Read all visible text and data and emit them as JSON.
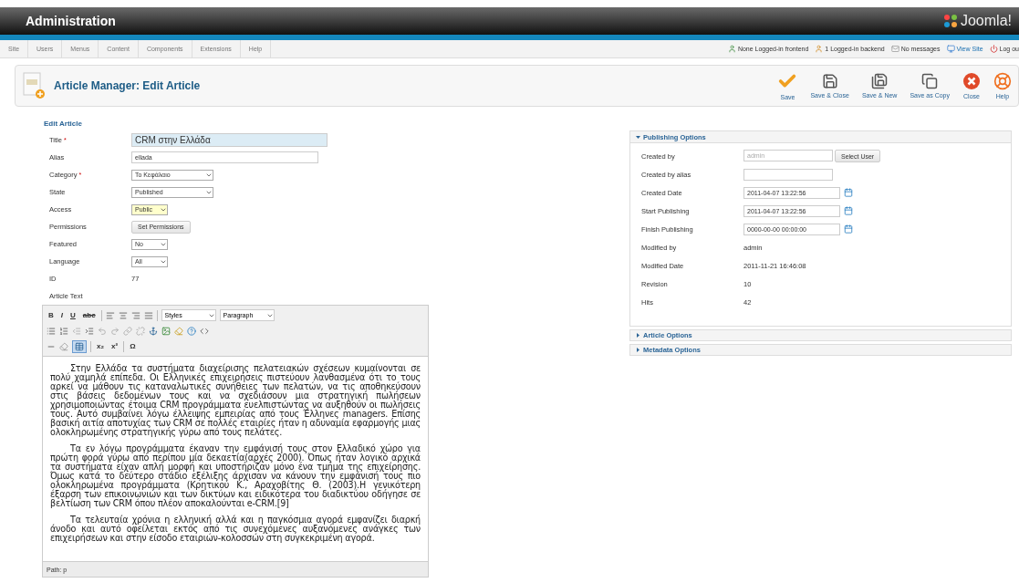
{
  "header": {
    "title": "Administration",
    "logo_text": "Joomla!"
  },
  "menu": {
    "items": [
      "Site",
      "Users",
      "Menus",
      "Content",
      "Components",
      "Extensions",
      "Help"
    ],
    "status": [
      {
        "kind": "frontend",
        "label": "None Logged-in frontend"
      },
      {
        "kind": "backend",
        "label": "1 Logged-in backend"
      },
      {
        "kind": "messages",
        "label": "No messages"
      },
      {
        "kind": "view",
        "label": "View Site"
      },
      {
        "kind": "logout",
        "label": "Log ou"
      }
    ]
  },
  "toolbar": {
    "title": "Article Manager: Edit Article",
    "buttons": [
      {
        "kind": "save",
        "label": "Save"
      },
      {
        "kind": "save_close",
        "label": "Save & Close"
      },
      {
        "kind": "save_new",
        "label": "Save & New"
      },
      {
        "kind": "save_copy",
        "label": "Save as Copy"
      },
      {
        "kind": "close",
        "label": "Close"
      },
      {
        "kind": "help",
        "label": "Help"
      }
    ]
  },
  "edit_article": {
    "legend": "Edit Article",
    "fields": [
      {
        "label": "Title",
        "mark": "*",
        "kind": "title",
        "value": "CRM στην Ελλάδα"
      },
      {
        "label": "Alias",
        "kind": "text",
        "value": "ellada"
      },
      {
        "label": "Category",
        "mark": "*",
        "kind": "select",
        "value": "Το Κεφάλαιο",
        "focused": false
      },
      {
        "label": "State",
        "kind": "select",
        "value": "Published",
        "focused": false
      },
      {
        "label": "Access",
        "kind": "select",
        "value": "Public",
        "focused": true
      },
      {
        "label": "Permissions",
        "kind": "button",
        "value": "Set Permissions"
      },
      {
        "label": "Featured",
        "kind": "select",
        "value": "No",
        "focused": false
      },
      {
        "label": "Language",
        "kind": "select",
        "value": "All",
        "focused": false
      },
      {
        "label": "ID",
        "kind": "value",
        "value": "77"
      }
    ],
    "text_label": "Article Text"
  },
  "editor": {
    "format_buttons": [
      "B",
      "I",
      "U",
      "abc"
    ],
    "selects": [
      "Styles",
      "Paragraph"
    ],
    "script_buttons": [
      "x₂",
      "x²",
      "Ω"
    ],
    "paragraphs": [
      "Στην Ελλάδα τα συστήματα διαχείρισης πελατειακών σχέσεων κυμαίνονται σε πολύ χαμηλά επίπεδα. Οι Ελληνικές επιχειρήσεις πιστεύουν λανθασμένα ότι το τους αρκεί να μάθουν τις καταναλωτικές συνήθειες των πελατών, να τις αποθηκεύσουν στις βάσεις δεδομένων τους και να σχεδιάσουν μια στρατηγική πωλήσεων χρησιμοποιώντας έτοιμα CRM προγράμματα ευελπιστώντας να αυξηθούν οι πωλήσεις τους. Αυτό συμβαίνει λόγω έλλειψης εμπειρίας από τους Έλληνες managers. Επίσης βασική αιτία αποτυχίας των CRM σε πολλές εταιρίες ήταν η αδυναμία εφαρμογής μιας ολοκληρωμένης στρατηγικής γύρω από τους πελάτες.",
      "Τα εν λόγω προγράμματα έκαναν την εμφάνισή τους στον Ελλαδικό χώρο για πρώτη φορά γύρω από περίπου μία δεκαετία(αρχές 2000). Όπως ήταν λογικό αρχικά τα συστήματα είχαν απλή μορφή και υποστήριζαν μόνο ένα τμήμα της επιχείρησης. Όμως κατά το δεύτερο στάδιο εξέλιξης άρχισαν να κάνουν την εμφάνισή τους πιο ολοκληρωμένα προγράμματα (Κρητικού Κ., Αραχοβίτης Θ. (2003).Η γενικότερη έξαρση των επικοινωνιών και των δικτύων και ειδικότερα του διαδικτύου οδήγησε σε βελτίωση των CRM όπου πλέον αποκαλούνται e-CRM.[9]",
      "Τα τελευταία χρόνια η ελληνική αλλά και η παγκόσμια αγορά εμφανίζει διαρκή άνοδο και αυτό οφείλεται εκτός από τις συνεχόμενες αυξανόμενες ανάγκες των επιχειρήσεων και στην είσοδο εταιριών-κολοσσών στη συγκεκριμένη αγορά."
    ],
    "path": "Path: p"
  },
  "publishing": {
    "title": "Publishing Options",
    "expanded": true,
    "fields": [
      {
        "label": "Created by",
        "kind": "user",
        "value": "admin",
        "button": "Select User"
      },
      {
        "label": "Created by alias",
        "kind": "text"
      },
      {
        "label": "Created Date",
        "kind": "date",
        "value": "2011-04-07 13:22:56"
      },
      {
        "label": "Start Publishing",
        "kind": "date",
        "value": "2011-04-07 13:22:56"
      },
      {
        "label": "Finish Publishing",
        "kind": "date",
        "value": "0000-00-00 00:00:00"
      },
      {
        "label": "Modified by",
        "kind": "value",
        "value": "admin"
      },
      {
        "label": "Modified Date",
        "kind": "value",
        "value": "2011-11-21 16:46:08"
      },
      {
        "label": "Revision",
        "kind": "value",
        "value": "10"
      },
      {
        "label": "Hits",
        "kind": "value",
        "value": "42"
      }
    ]
  },
  "panels": [
    {
      "title": "Article Options",
      "expanded": false
    },
    {
      "title": "Metadata Options",
      "expanded": false
    }
  ]
}
